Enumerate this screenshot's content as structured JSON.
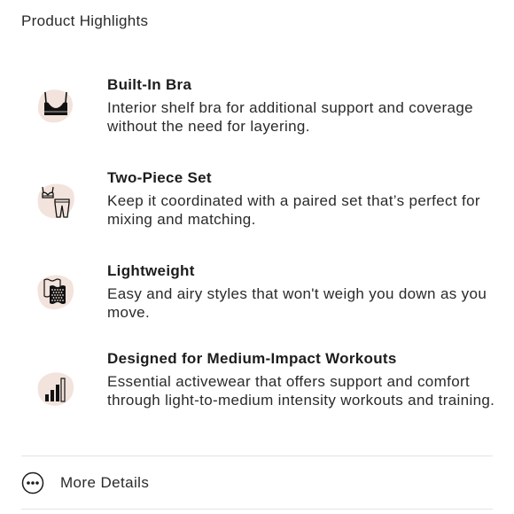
{
  "section": {
    "title": "Product Highlights"
  },
  "features": [
    {
      "title": "Built-In Bra",
      "description": "Interior shelf bra for additional support and coverage without the need for layering.",
      "icon": "sports-bra-icon"
    },
    {
      "title": "Two-Piece Set",
      "description": "Keep it coordinated with a paired set that’s perfect for mixing and matching.",
      "icon": "two-piece-set-icon"
    },
    {
      "title": "Lightweight",
      "description": "Easy and airy styles that won't weigh you down as you move.",
      "icon": "lightweight-fabric-icon"
    },
    {
      "title": "Designed for Medium-Impact Workouts",
      "description": "Essential activewear that offers support and comfort through light-to-medium intensity workouts and training.",
      "icon": "impact-level-bars-icon"
    }
  ],
  "more_details": {
    "label": "More Details",
    "icon": "more-dots-icon"
  },
  "colors": {
    "icon_blob": "#f2e3dc",
    "text": "#2a2a2a",
    "divider": "#e4e4e4"
  }
}
